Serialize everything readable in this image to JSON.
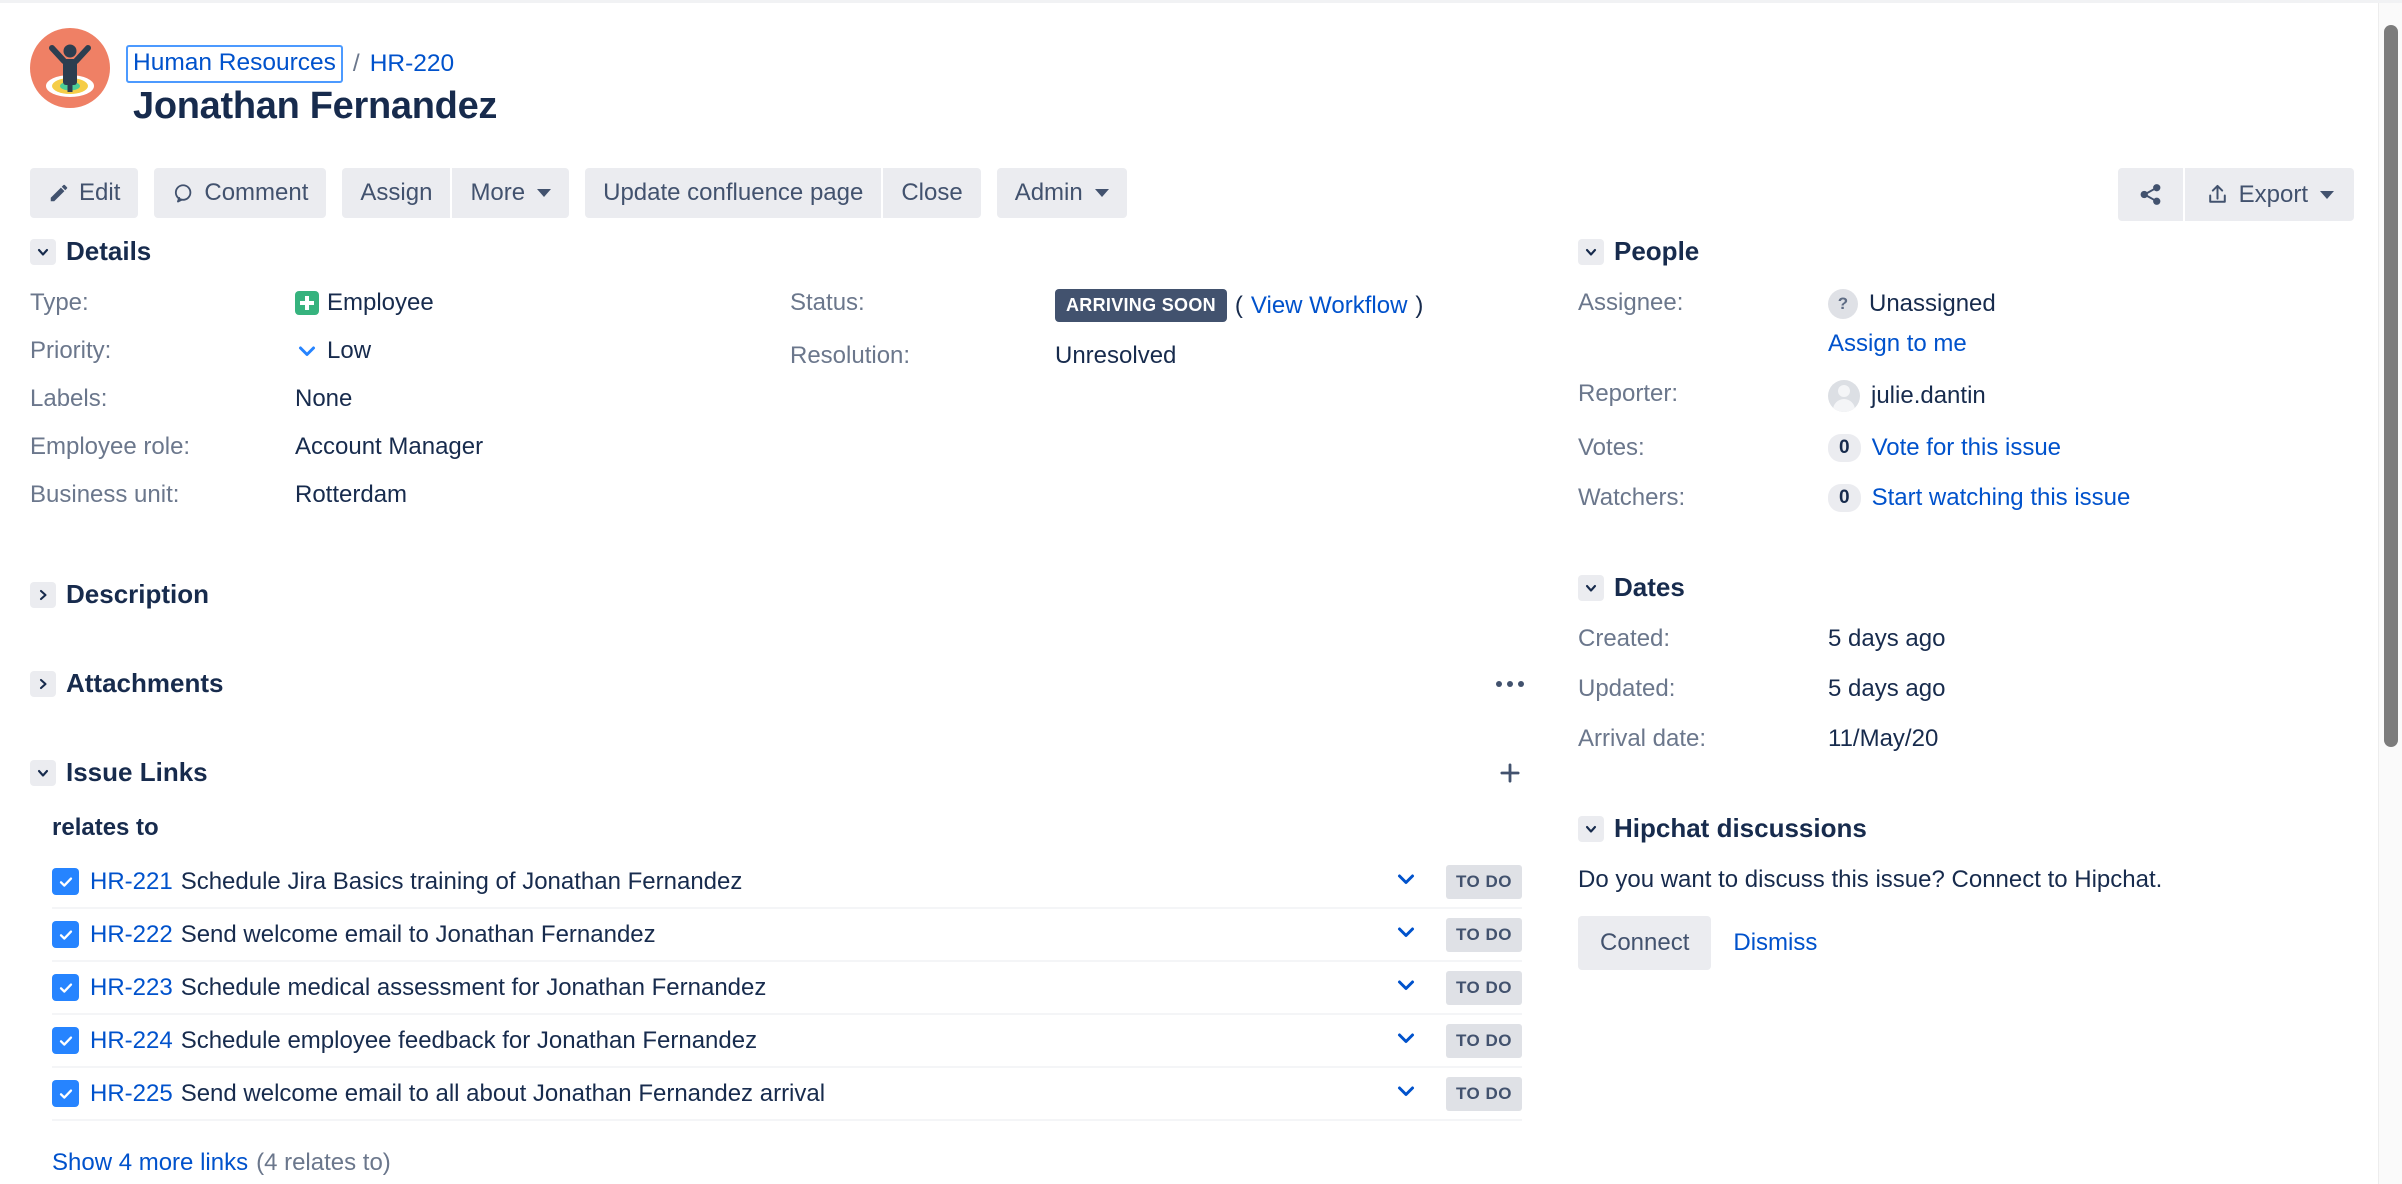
{
  "header": {
    "project_avatar_icon": "person-on-target-icon",
    "breadcrumb_project": "Human Resources",
    "breadcrumb_separator": "/",
    "breadcrumb_issue_key": "HR-220",
    "issue_title": "Jonathan Fernandez"
  },
  "toolbar": {
    "edit_label": "Edit",
    "comment_label": "Comment",
    "assign_label": "Assign",
    "more_label": "More",
    "update_confluence_label": "Update confluence page",
    "close_label": "Close",
    "admin_label": "Admin",
    "share_icon": "share-icon",
    "export_label": "Export",
    "export_icon": "upload-icon"
  },
  "details": {
    "section_title": "Details",
    "expanded": true,
    "fields": [
      {
        "label": "Type:",
        "value": "Employee",
        "icon": "employee-type-icon"
      },
      {
        "label": "Priority:",
        "value": "Low",
        "icon": "priority-low-icon"
      },
      {
        "label": "Labels:",
        "value": "None",
        "icon": ""
      },
      {
        "label": "Employee role:",
        "value": "Account Manager",
        "icon": ""
      },
      {
        "label": "Business unit:",
        "value": "Rotterdam",
        "icon": ""
      }
    ],
    "status_label": "Status:",
    "status_value": "ARRIVING SOON",
    "status_color": "#42526e",
    "view_workflow_open": "(",
    "view_workflow_label": "View Workflow",
    "view_workflow_close": ")",
    "resolution_label": "Resolution:",
    "resolution_value": "Unresolved"
  },
  "description": {
    "section_title": "Description",
    "expanded": false
  },
  "attachments": {
    "section_title": "Attachments",
    "expanded": false,
    "menu_icon": "more-options-icon"
  },
  "issue_links": {
    "section_title": "Issue Links",
    "expanded": true,
    "add_icon": "plus-icon",
    "group_title": "relates to",
    "rows": [
      {
        "key": "HR-221",
        "summary": "Schedule Jira Basics training of Jonathan Fernandez",
        "status": "TO DO",
        "priority_icon": "priority-low-icon",
        "checked": true
      },
      {
        "key": "HR-222",
        "summary": "Send welcome email to Jonathan Fernandez",
        "status": "TO DO",
        "priority_icon": "priority-low-icon",
        "checked": true
      },
      {
        "key": "HR-223",
        "summary": "Schedule medical assessment for Jonathan Fernandez",
        "status": "TO DO",
        "priority_icon": "priority-low-icon",
        "checked": true
      },
      {
        "key": "HR-224",
        "summary": "Schedule employee feedback for Jonathan Fernandez",
        "status": "TO DO",
        "priority_icon": "priority-low-icon",
        "checked": true
      },
      {
        "key": "HR-225",
        "summary": "Send welcome email to all about Jonathan Fernandez arrival",
        "status": "TO DO",
        "priority_icon": "priority-low-icon",
        "checked": true
      }
    ],
    "show_more_label": "Show 4 more links",
    "show_more_count": "(4 relates to)"
  },
  "people": {
    "section_title": "People",
    "expanded": true,
    "assignee_label": "Assignee:",
    "assignee_value": "Unassigned",
    "assignee_avatar_icon": "question-avatar-icon",
    "assign_to_me_label": "Assign to me",
    "reporter_label": "Reporter:",
    "reporter_value": "julie.dantin",
    "reporter_avatar_icon": "user-avatar-icon",
    "votes_label": "Votes:",
    "votes_count": "0",
    "votes_action_label": "Vote for this issue",
    "watchers_label": "Watchers:",
    "watchers_count": "0",
    "watchers_action_label": "Start watching this issue"
  },
  "dates": {
    "section_title": "Dates",
    "expanded": true,
    "rows": [
      {
        "label": "Created:",
        "value": "5 days ago"
      },
      {
        "label": "Updated:",
        "value": "5 days ago"
      },
      {
        "label": "Arrival date:",
        "value": "11/May/20"
      }
    ]
  },
  "hipchat": {
    "section_title": "Hipchat discussions",
    "expanded": true,
    "prompt": "Do you want to discuss this issue? Connect to Hipchat.",
    "connect_label": "Connect",
    "dismiss_label": "Dismiss"
  },
  "colors": {
    "link": "#0052cc",
    "accent_blue": "#2684ff",
    "status_dark": "#42526e",
    "type_green": "#36b37e",
    "avatar_coral": "#ef8065"
  }
}
